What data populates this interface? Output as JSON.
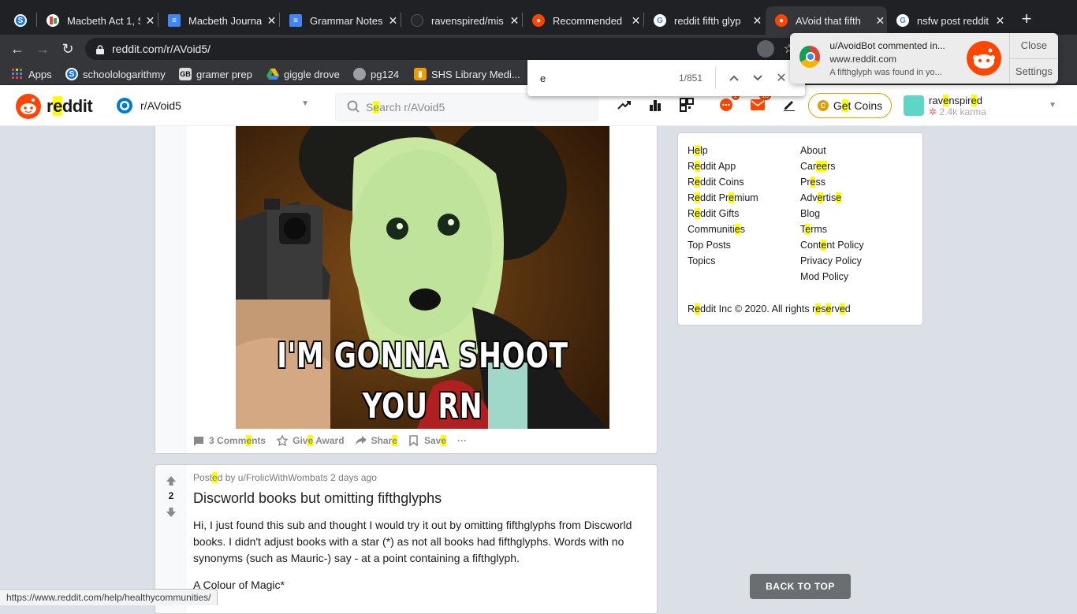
{
  "browser": {
    "tabs": [
      {
        "label": "",
        "icon": "site-icon",
        "color": "#1a73e8",
        "close": ""
      },
      {
        "label": "Macbeth Act 1, S",
        "icon": "chart-icon",
        "color": "#ffffff",
        "close": "✕"
      },
      {
        "label": "Macbeth Journa",
        "icon": "docs-icon",
        "color": "#4285f4",
        "close": "✕"
      },
      {
        "label": "Grammar Notes",
        "icon": "docs-icon",
        "color": "#4285f4",
        "close": "✕"
      },
      {
        "label": "ravenspired/mis",
        "icon": "github-icon",
        "color": "#24292e",
        "close": "✕"
      },
      {
        "label": "Recommended",
        "icon": "reddit-icon",
        "color": "#ff4500",
        "close": "✕"
      },
      {
        "label": "reddit fifth glyp",
        "icon": "google-icon",
        "color": "#ffffff",
        "close": "✕"
      },
      {
        "label": "AVoid that fifth",
        "icon": "reddit-icon",
        "color": "#ff4500",
        "close": "✕"
      },
      {
        "label": "nsfw post reddit",
        "icon": "google-icon",
        "color": "#ffffff",
        "close": "✕"
      }
    ],
    "new_tab": "+",
    "back": "←",
    "forward": "→",
    "reload": "↻",
    "url": "reddit.com/r/AVoid5/",
    "bookmarks": [
      {
        "label": "Apps",
        "icon": "apps-grid-icon"
      },
      {
        "label": "schoolologarithmy",
        "icon": "schoology-icon"
      },
      {
        "label": "gramer prep",
        "icon": "gb-icon"
      },
      {
        "label": "giggle drove",
        "icon": "drive-icon"
      },
      {
        "label": "pg124",
        "icon": "globe-icon"
      },
      {
        "label": "SHS Library Medi...",
        "icon": "library-icon"
      }
    ],
    "status_url": "https://www.reddit.com/help/healthycommunities/"
  },
  "findbar": {
    "query": "e",
    "count": "1/851",
    "prev": "⌃",
    "next": "⌄",
    "close": "✕"
  },
  "notification": {
    "title": "u/AvoidBot commented in...",
    "site": "www.reddit.com",
    "message": "A fifthglyph was found in yo...",
    "close_label": "Close",
    "settings_label": "Settings"
  },
  "reddit_header": {
    "wordmark": "reddit",
    "subreddit": "r/AVoid5",
    "search_placeholder": "Search r/AVoid5",
    "get_coins": "Get Coins",
    "username": "ravenspired",
    "karma": "2.4k karma",
    "chat_badge": "1",
    "mail_badge": "13"
  },
  "post1": {
    "meme_line1": "I'M GONNA SHOOT",
    "meme_line2": "YOU RN",
    "comments": "3 Comments",
    "give_award": "Give Award",
    "share": "Share",
    "save": "Save",
    "more": "···"
  },
  "post2": {
    "score": "2",
    "meta": "Posted by u/FrolicWithWombats 2 days ago",
    "title": "Discworld books but omitting fifthglyphs",
    "body": "Hi, I just found this sub and thought I would try it out by omitting fifthglyphs from Discworld books. I didn't adjust books with a star (*) as not all books had fifthglyphs. Words with no synonyms (such as Mauric-) say - at a point containing a fifthglyph.",
    "body2": "A Colour of Magic*"
  },
  "sidebar": {
    "col1": [
      "Help",
      "Reddit App",
      "Reddit Coins",
      "Reddit Premium",
      "Reddit Gifts",
      "Communities",
      "Top Posts",
      "Topics"
    ],
    "col2": [
      "About",
      "Careers",
      "Press",
      "Advertise",
      "Blog",
      "Terms",
      "Content Policy",
      "Privacy Policy",
      "Mod Policy"
    ],
    "copyright": "Reddit Inc © 2020. All rights reserved"
  },
  "back_to_top": "BACK TO TOP",
  "colors": {
    "reddit_orange": "#ff4500",
    "find_highlight": "#ffff00",
    "chrome_dark": "#202124",
    "chrome_toolbar": "#35363a",
    "coin_gold": "#dda000"
  }
}
